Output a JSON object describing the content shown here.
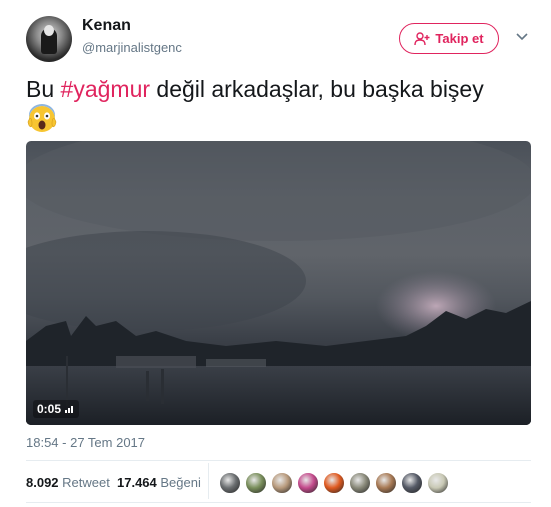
{
  "author": {
    "name": "Kenan",
    "handle": "@marjinalistgenc",
    "avatar_icon": "user-avatar"
  },
  "follow": {
    "label": "Takip et",
    "icon": "add-user-icon",
    "color": "#e0245e"
  },
  "menu": {
    "icon": "chevron-down-icon"
  },
  "tweet": {
    "text_before": "Bu ",
    "hashtag": "#yağmur",
    "text_after": " değil arkadaşlar, bu başka bişey",
    "emoji": "face-screaming-in-fear"
  },
  "video": {
    "duration": "0:05",
    "icon": "volume-icon"
  },
  "timestamp": "18:54 - 27 Tem 2017",
  "stats": {
    "retweet_count": "8.092",
    "retweet_label": "Retweet",
    "like_count": "17.464",
    "like_label": "Beğeni"
  },
  "likers": [
    {
      "color": "#6b6e70"
    },
    {
      "color": "#7a8f5c"
    },
    {
      "color": "#b89a7c"
    },
    {
      "color": "#c44a8c"
    },
    {
      "color": "#e05a20"
    },
    {
      "color": "#8a8a7a"
    },
    {
      "color": "#a87a55"
    },
    {
      "color": "#555a66"
    },
    {
      "color": "#c9c9b5"
    }
  ]
}
